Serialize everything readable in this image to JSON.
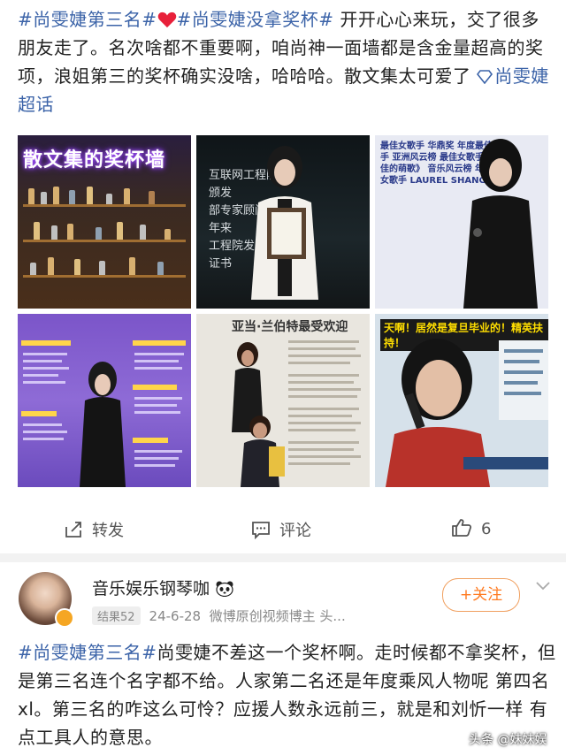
{
  "post": {
    "tag1": "#尚雯婕第三名#",
    "tag2": "#尚雯婕没拿奖杯#",
    "text1": " 开开心心来玩，交了很多朋友走了。名次啥都不重要啊，咱尚神一面墙都是含金量超高的奖项，浪姐第三的奖杯确实没啥，哈哈哈。散文集太可爱了",
    "super_topic": "尚雯婕超话"
  },
  "images": {
    "tile1_title": "散文集的奖杯墙",
    "tile2_lines": [
      "互联网工程院",
      "颁发",
      "部专家顾问证",
      "年来",
      "工程院发出",
      "证书"
    ],
    "tile3_words": "最佳女歌手 华鼎奖 年度最佳女歌手 亚洲风云榜 最佳女歌手 《最佳的萌歌》 音乐风云榜 年度最佳女歌手 LAUREL SHANG",
    "tile5_head": "亚当·兰伯特最受欢迎",
    "tile6_banner": "天啊！居然是复旦毕业的！精英扶持！"
  },
  "actions": {
    "repost": "转发",
    "comment": "评论",
    "like_count": "6"
  },
  "reply": {
    "username": "音乐娱乐钢琴咖",
    "badge": "结果52",
    "date": "24-6-28",
    "desc": "微博原创视频博主 头...",
    "follow": "+关注",
    "tag": "#尚雯婕第三名#",
    "text": "尚雯婕不差这一个奖杯啊。走时候都不拿奖杯，但是第三名连个名字都不给。人家第二名还是年度乘风人物呢 第四名 xl。第三名的咋这么可怜？应援人数永远前三，就是和刘忻一样 有点工具人的意思。"
  },
  "watermark": "头条 @妹妹娱",
  "colors": {
    "tag": "#3b63a8",
    "follow": "#ff7a20"
  }
}
